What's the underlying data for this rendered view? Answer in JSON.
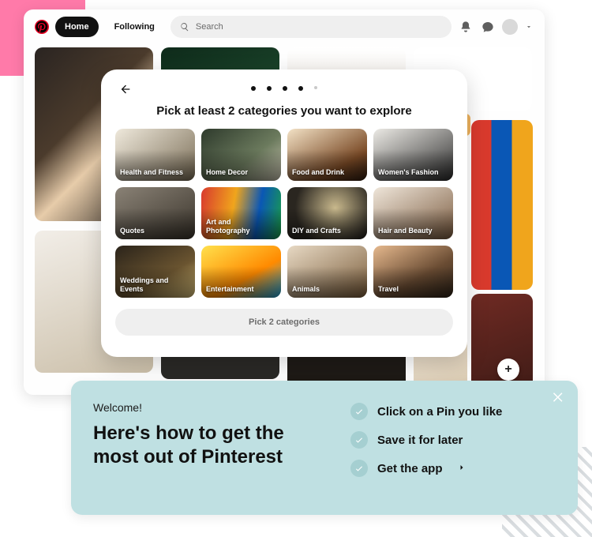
{
  "colors": {
    "accent_pink": "#ff7aa9",
    "brand_red": "#e60023",
    "teal_card": "#bfe0e2"
  },
  "header": {
    "home_label": "Home",
    "following_label": "Following",
    "search_placeholder": "Search"
  },
  "modal": {
    "title": "Pick at least 2 categories you want to explore",
    "categories": [
      {
        "label": "Health and Fitness"
      },
      {
        "label": "Home Decor"
      },
      {
        "label": "Food and Drink"
      },
      {
        "label": "Women's Fashion"
      },
      {
        "label": "Quotes"
      },
      {
        "label": "Art and Photography"
      },
      {
        "label": "DIY and Crafts"
      },
      {
        "label": "Hair and Beauty"
      },
      {
        "label": "Weddings and Events"
      },
      {
        "label": "Entertainment"
      },
      {
        "label": "Animals"
      },
      {
        "label": "Travel"
      }
    ],
    "cta_label": "Pick 2 categories",
    "progress_dots": {
      "total": 5,
      "current": 4
    }
  },
  "welcome": {
    "eyebrow": "Welcome!",
    "headline": "Here's how to get the most out of Pinterest",
    "steps": [
      {
        "label": "Click on a Pin you like"
      },
      {
        "label": "Save it for later"
      },
      {
        "label": "Get the app",
        "has_arrow": true
      }
    ]
  },
  "fab": {
    "glyph": "+"
  }
}
